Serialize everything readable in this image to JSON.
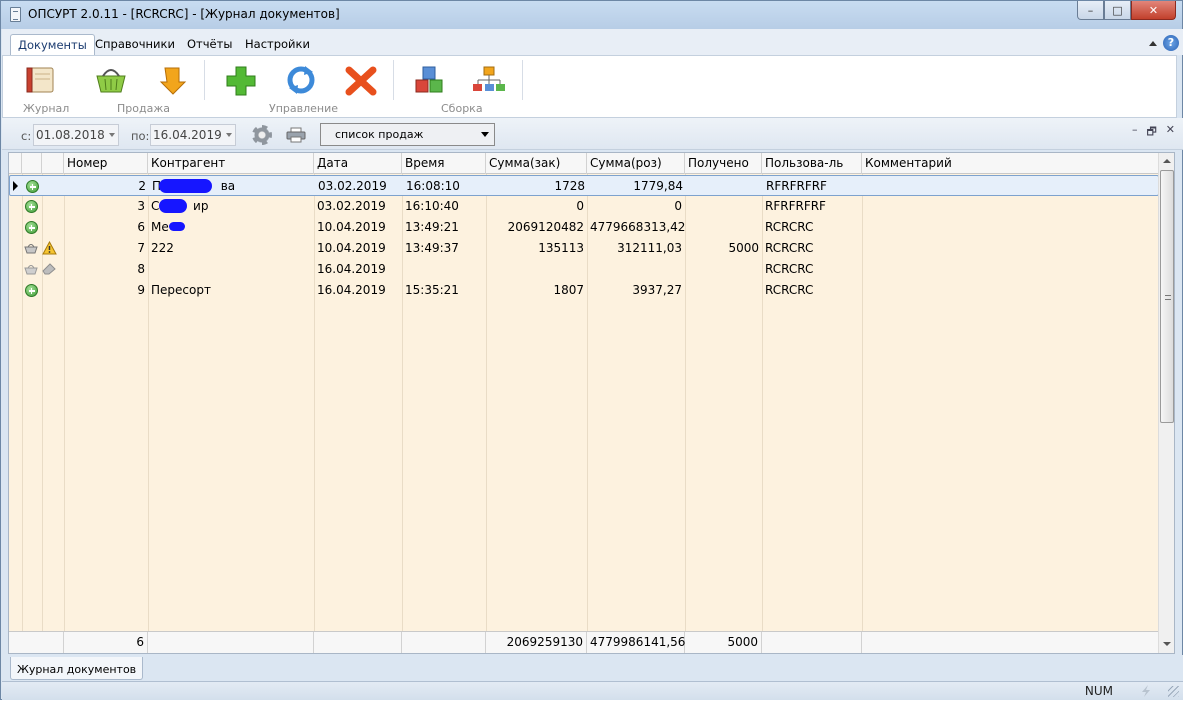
{
  "window": {
    "title": "ОПСУРТ  2.0.11 - [RCRCRC] - [Журнал документов]",
    "minimize": "–",
    "maximize": "□",
    "close": "✕"
  },
  "ribbon_tabs": [
    {
      "label": "Документы",
      "active": true
    },
    {
      "label": "Справочники",
      "active": false
    },
    {
      "label": "Отчёты",
      "active": false
    },
    {
      "label": "Настройки",
      "active": false
    }
  ],
  "ribbon_groups": {
    "journal": "Журнал",
    "sale": "Продажа",
    "manage": "Управление",
    "assembly": "Сборка"
  },
  "help": "?",
  "filter": {
    "from_label": "с:",
    "from_date": "01.08.2018",
    "to_label": "по:",
    "to_date": "16.04.2019",
    "list_type": "список продаж"
  },
  "mdi": {
    "minimize": "–",
    "restore": "🗗",
    "close": "✕"
  },
  "columns": [
    "Номер",
    "Контрагент",
    "Дата",
    "Время",
    "Сумма(зак)",
    "Сумма(роз)",
    "Получено",
    "Пользова-ль",
    "Комментарий"
  ],
  "rows": [
    {
      "icon": "plus",
      "warn": false,
      "number": "2",
      "contractor": "П",
      "contractor_tail": "ва",
      "date": "03.02.2019",
      "time": "16:08:10",
      "sum_purchase": "1728",
      "sum_retail": "1779,84",
      "received": "",
      "user": "RFRFRFRF",
      "comment": "",
      "selected": true
    },
    {
      "icon": "plus",
      "warn": false,
      "number": "3",
      "contractor": "С",
      "contractor_tail": "ир",
      "date": "03.02.2019",
      "time": "16:10:40",
      "sum_purchase": "0",
      "sum_retail": "0",
      "received": "",
      "user": "RFRFRFRF",
      "comment": "",
      "selected": false
    },
    {
      "icon": "plus",
      "warn": false,
      "number": "6",
      "contractor": "Ме",
      "contractor_tail": "",
      "date": "10.04.2019",
      "time": "13:49:21",
      "sum_purchase": "2069120482",
      "sum_retail": "4779668313,42",
      "received": "",
      "user": "RCRCRC",
      "comment": "",
      "selected": false
    },
    {
      "icon": "basket",
      "warn": true,
      "number": "7",
      "contractor": "222",
      "contractor_tail": "",
      "date": "10.04.2019",
      "time": "13:49:37",
      "sum_purchase": "135113",
      "sum_retail": "312111,03",
      "received": "5000",
      "user": "RCRCRC",
      "comment": "",
      "selected": false
    },
    {
      "icon": "basket-gray",
      "warn": false,
      "number": "8",
      "contractor": "",
      "contractor_tail": "",
      "date": "16.04.2019",
      "time": "",
      "sum_purchase": "",
      "sum_retail": "",
      "received": "",
      "user": "RCRCRC",
      "comment": "",
      "selected": false
    },
    {
      "icon": "plus",
      "warn": false,
      "number": "9",
      "contractor": "Пересорт",
      "contractor_tail": "",
      "date": "16.04.2019",
      "time": "15:35:21",
      "sum_purchase": "1807",
      "sum_retail": "3937,27",
      "received": "",
      "user": "RCRCRC",
      "comment": "",
      "selected": false
    }
  ],
  "totals": {
    "count": "6",
    "sum_purchase": "2069259130",
    "sum_retail": "4779986141,56",
    "received": "5000"
  },
  "document_tab": "Журнал документов",
  "status": {
    "num": "NUM"
  }
}
